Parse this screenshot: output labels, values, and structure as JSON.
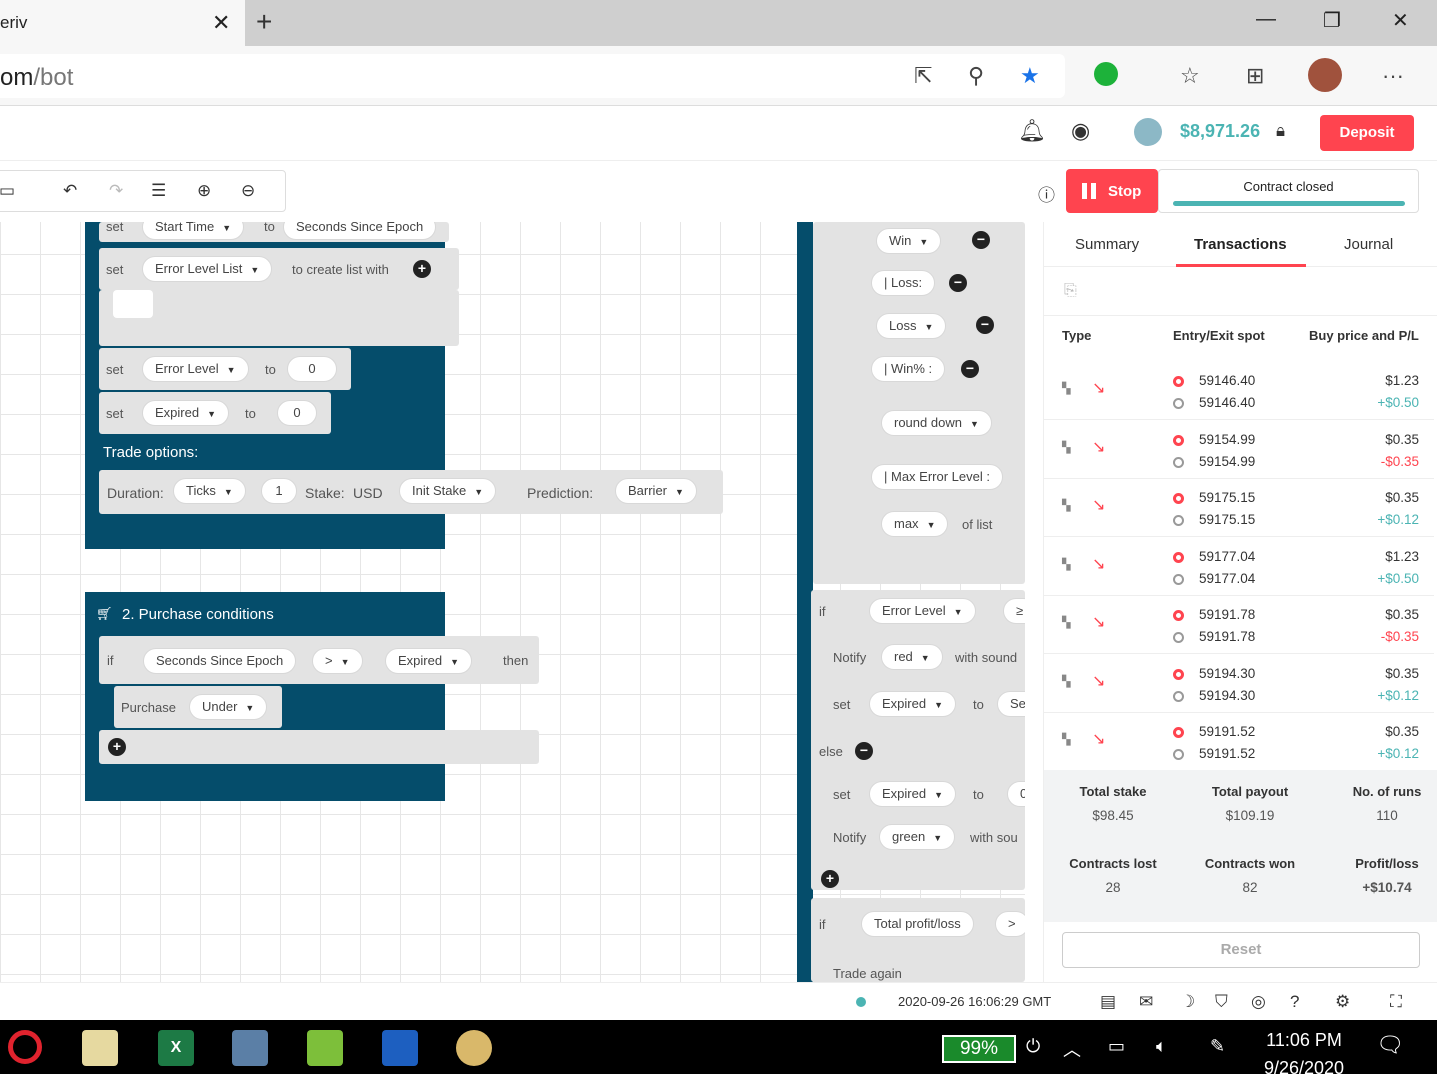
{
  "browser": {
    "tab_title": "eriv",
    "url_visible": "om",
    "url_rest": "/bot",
    "min": "—",
    "max": "❐",
    "close": "✕"
  },
  "header": {
    "balance": "$8,971.26",
    "deposit_label": "Deposit"
  },
  "run_panel": {
    "stop_label": "Stop",
    "status_label": "Contract closed"
  },
  "workspace": {
    "set": "set",
    "to": "to",
    "start_time": "Start Time",
    "seconds_since_epoch": "Seconds Since Epoch",
    "error_level_list": "Error Level List",
    "create_list_with": "to create list with",
    "error_level": "Error Level",
    "zero": "0",
    "expired": "Expired",
    "trade_options": "Trade options:",
    "duration": "Duration:",
    "ticks": "Ticks",
    "one": "1",
    "stake": "Stake:",
    "usd": "USD",
    "init_stake": "Init Stake",
    "prediction": "Prediction:",
    "barrier": "Barrier",
    "purchase_conditions": "2. Purchase conditions",
    "if": "if",
    "gt": ">",
    "then": "then",
    "purchase": "Purchase",
    "under": "Under",
    "win": "Win",
    "loss_label": "| Loss:",
    "loss": "Loss",
    "winpct": "| Win% :",
    "round_down": "round down",
    "max_error_level": "| Max Error Level :",
    "max": "max",
    "of_list": "of list",
    "ge": "≥",
    "notify": "Notify",
    "red": "red",
    "with_sound": "with sound",
    "sec": "Sec",
    "else": "else",
    "green": "green",
    "with_sou": "with sou",
    "total_profit_loss": "Total profit/loss",
    "trade_again": "Trade again",
    "zero_partial": "0"
  },
  "panel": {
    "tabs": [
      "Summary",
      "Transactions",
      "Journal"
    ],
    "columns": [
      "Type",
      "Entry/Exit spot",
      "Buy price and P/L"
    ],
    "rows": [
      {
        "entry": "59146.40",
        "exit": "59146.40",
        "price": "$1.23",
        "pl": "+$0.50",
        "positive": true
      },
      {
        "entry": "59154.99",
        "exit": "59154.99",
        "price": "$0.35",
        "pl": "-$0.35",
        "positive": false
      },
      {
        "entry": "59175.15",
        "exit": "59175.15",
        "price": "$0.35",
        "pl": "+$0.12",
        "positive": true
      },
      {
        "entry": "59177.04",
        "exit": "59177.04",
        "price": "$1.23",
        "pl": "+$0.50",
        "positive": true
      },
      {
        "entry": "59191.78",
        "exit": "59191.78",
        "price": "$0.35",
        "pl": "-$0.35",
        "positive": false
      },
      {
        "entry": "59194.30",
        "exit": "59194.30",
        "price": "$0.35",
        "pl": "+$0.12",
        "positive": true
      },
      {
        "entry": "59191.52",
        "exit": "59191.52",
        "price": "$0.35",
        "pl": "+$0.12",
        "positive": true
      }
    ],
    "summary": {
      "total_stake_label": "Total stake",
      "total_stake": "$98.45",
      "total_payout_label": "Total payout",
      "total_payout": "$109.19",
      "runs_label": "No. of runs",
      "runs": "110",
      "lost_label": "Contracts lost",
      "lost": "28",
      "won_label": "Contracts won",
      "won": "82",
      "pl_label": "Profit/loss",
      "pl": "+$10.74"
    },
    "reset_label": "Reset"
  },
  "footer": {
    "datetime": "2020-09-26 16:06:29 GMT"
  },
  "taskbar": {
    "battery": "99%",
    "time": "11:06 PM",
    "date": "9/26/2020"
  },
  "colors": {
    "brand_red": "#ff444f",
    "teal": "#4bb4b3",
    "block_blue": "#054d6b"
  }
}
